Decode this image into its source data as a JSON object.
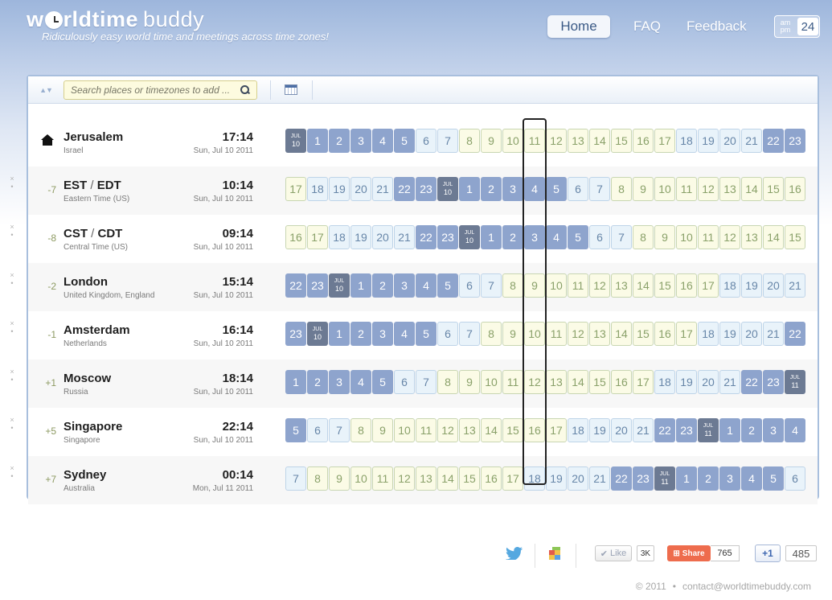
{
  "header": {
    "logo_main": "w",
    "logo_rest": "rldtime",
    "logo_buddy": "buddy",
    "tagline": "Ridiculously easy world time and meetings across time zones!"
  },
  "nav": {
    "home": "Home",
    "faq": "FAQ",
    "feedback": "Feedback"
  },
  "clock_format": {
    "ampm_top": "am",
    "ampm_bottom": "pm",
    "h24": "24"
  },
  "search": {
    "placeholder": "Search places or timezones to add ..."
  },
  "rows": [
    {
      "offset": "",
      "name": "Jerusalem",
      "abbr_a": "",
      "abbr_b": "",
      "sub": "Israel",
      "time": "17:14",
      "date": "Sun, Jul 10 2011",
      "is_home": true,
      "hours": [
        "JUL|10",
        "1",
        "2",
        "3",
        "4",
        "5",
        "6",
        "7",
        "8",
        "9",
        "10",
        "11",
        "12",
        "13",
        "14",
        "15",
        "16",
        "17",
        "18",
        "19",
        "20",
        "21",
        "22",
        "23"
      ]
    },
    {
      "offset": "-7",
      "name": "",
      "abbr_a": "EST",
      "abbr_b": "EDT",
      "sub": "Eastern Time (US)",
      "time": "10:14",
      "date": "Sun, Jul 10 2011",
      "is_home": false,
      "hours": [
        "17",
        "18",
        "19",
        "20",
        "21",
        "22",
        "23",
        "JUL|10",
        "1",
        "2",
        "3",
        "4",
        "5",
        "6",
        "7",
        "8",
        "9",
        "10",
        "11",
        "12",
        "13",
        "14",
        "15",
        "16"
      ]
    },
    {
      "offset": "-8",
      "name": "",
      "abbr_a": "CST",
      "abbr_b": "CDT",
      "sub": "Central Time (US)",
      "time": "09:14",
      "date": "Sun, Jul 10 2011",
      "is_home": false,
      "hours": [
        "16",
        "17",
        "18",
        "19",
        "20",
        "21",
        "22",
        "23",
        "JUL|10",
        "1",
        "2",
        "3",
        "4",
        "5",
        "6",
        "7",
        "8",
        "9",
        "10",
        "11",
        "12",
        "13",
        "14",
        "15"
      ]
    },
    {
      "offset": "-2",
      "name": "London",
      "abbr_a": "",
      "abbr_b": "",
      "sub": "United Kingdom, England",
      "time": "15:14",
      "date": "Sun, Jul 10 2011",
      "is_home": false,
      "hours": [
        "22",
        "23",
        "JUL|10",
        "1",
        "2",
        "3",
        "4",
        "5",
        "6",
        "7",
        "8",
        "9",
        "10",
        "11",
        "12",
        "13",
        "14",
        "15",
        "16",
        "17",
        "18",
        "19",
        "20",
        "21"
      ]
    },
    {
      "offset": "-1",
      "name": "Amsterdam",
      "abbr_a": "",
      "abbr_b": "",
      "sub": "Netherlands",
      "time": "16:14",
      "date": "Sun, Jul 10 2011",
      "is_home": false,
      "hours": [
        "23",
        "JUL|10",
        "1",
        "2",
        "3",
        "4",
        "5",
        "6",
        "7",
        "8",
        "9",
        "10",
        "11",
        "12",
        "13",
        "14",
        "15",
        "16",
        "17",
        "18",
        "19",
        "20",
        "21",
        "22"
      ]
    },
    {
      "offset": "+1",
      "name": "Moscow",
      "abbr_a": "",
      "abbr_b": "",
      "sub": "Russia",
      "time": "18:14",
      "date": "Sun, Jul 10 2011",
      "is_home": false,
      "hours": [
        "1",
        "2",
        "3",
        "4",
        "5",
        "6",
        "7",
        "8",
        "9",
        "10",
        "11",
        "12",
        "13",
        "14",
        "15",
        "16",
        "17",
        "18",
        "19",
        "20",
        "21",
        "22",
        "23",
        "JUL|11"
      ]
    },
    {
      "offset": "+5",
      "name": "Singapore",
      "abbr_a": "",
      "abbr_b": "",
      "sub": "Singapore",
      "time": "22:14",
      "date": "Sun, Jul 10 2011",
      "is_home": false,
      "hours": [
        "5",
        "6",
        "7",
        "8",
        "9",
        "10",
        "11",
        "12",
        "13",
        "14",
        "15",
        "16",
        "17",
        "18",
        "19",
        "20",
        "21",
        "22",
        "23",
        "JUL|11",
        "1",
        "2",
        "3",
        "4"
      ]
    },
    {
      "offset": "+7",
      "name": "Sydney",
      "abbr_a": "",
      "abbr_b": "",
      "sub": "Australia",
      "time": "00:14",
      "date": "Mon, Jul 11 2011",
      "is_home": false,
      "hours": [
        "7",
        "8",
        "9",
        "10",
        "11",
        "12",
        "13",
        "14",
        "15",
        "16",
        "17",
        "18",
        "19",
        "20",
        "21",
        "22",
        "23",
        "JUL|11",
        "1",
        "2",
        "3",
        "4",
        "5",
        "6"
      ]
    }
  ],
  "row_controls": {
    "remove": "×",
    "pin": "•"
  },
  "selected_column_index": 11,
  "social": {
    "like_label": "Like",
    "like_count": "3K",
    "share_label": "Share",
    "share_count": "765",
    "plus_label": "+1",
    "plus_count": "485"
  },
  "footer": {
    "copyright": "© 2011",
    "separator": "•",
    "contact": "contact@worldtimebuddy.com"
  },
  "colors": {
    "night": "#8ea4cd",
    "day": "#e9f3fa",
    "work": "#fbfbe6",
    "midnight": "#6c7a93",
    "accent": "#3b5a86"
  }
}
